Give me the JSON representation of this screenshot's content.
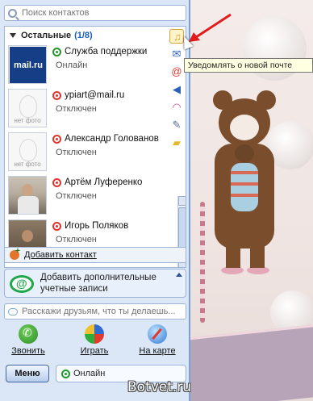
{
  "search": {
    "placeholder": "Поиск контактов"
  },
  "group": {
    "name": "Остальные",
    "count": "(1/8)"
  },
  "contacts": [
    {
      "name": "Служба поддержки",
      "status": "Онлайн",
      "photo": "mail.ru"
    },
    {
      "name": "ypiart@mail.ru",
      "status": "Отключен",
      "photo": "нет фото"
    },
    {
      "name": "Александр Голованов",
      "status": "Отключен",
      "photo": "нет фото"
    },
    {
      "name": "Артём Луференко",
      "status": "Отключен",
      "photo": ""
    },
    {
      "name": "Игорь Поляков",
      "status": "Отключен",
      "photo": ""
    }
  ],
  "add_contact": {
    "label": "Добавить контакт"
  },
  "add_accounts": {
    "line1": "Добавить дополнительные",
    "line2": "учетные записи"
  },
  "microblog": {
    "placeholder": "Расскажи друзьям, что ты делаешь..."
  },
  "actions": {
    "call": "Звонить",
    "play": "Играть",
    "map": "На карте"
  },
  "bottom": {
    "menu": "Меню",
    "status": "Онлайн"
  },
  "tooltip": {
    "text": "Уведомлять о новой почте"
  },
  "watermark": "Botvet.ru",
  "colors": {
    "window_bg": "#dbe7f6",
    "accent_blue": "#1a5fb4",
    "online_green": "#1f9a2a",
    "offline_red": "#e0352b",
    "arrow_red": "#e21b1b"
  }
}
